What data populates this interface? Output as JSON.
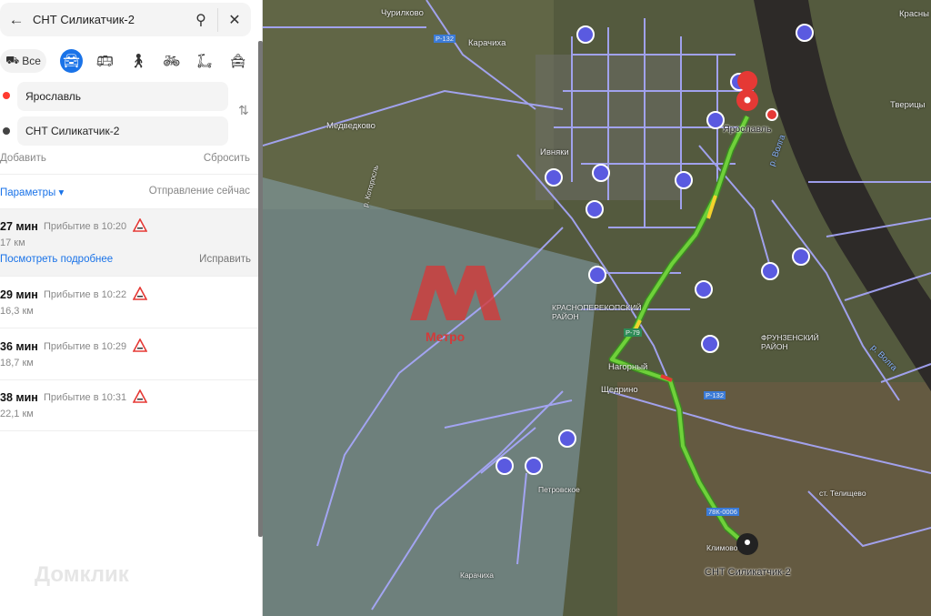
{
  "search": {
    "query": "СНТ Силикатчик-2"
  },
  "modes": {
    "all_label": "Все",
    "items": [
      "car",
      "bus",
      "walk",
      "bike",
      "scooter",
      "taxi"
    ]
  },
  "points": {
    "from": "Ярославль",
    "to": "СНТ Силикатчик-2"
  },
  "actions": {
    "add": "Добавить",
    "reset": "Сбросить",
    "params": "Параметры ▾",
    "departure": "Отправление сейчас",
    "details": "Посмотреть подробнее",
    "fix": "Исправить"
  },
  "routes": [
    {
      "time": "27 мин",
      "arrival": "Прибытие в 10:20",
      "distance": "17 км"
    },
    {
      "time": "29 мин",
      "arrival": "Прибытие в 10:22",
      "distance": "16,3 км"
    },
    {
      "time": "36 мин",
      "arrival": "Прибытие в 10:29",
      "distance": "18,7 км"
    },
    {
      "time": "38 мин",
      "arrival": "Прибытие в 10:31",
      "distance": "22,1 км"
    }
  ],
  "map": {
    "labels": {
      "churilkovo": "Чурилково",
      "karachikha1": "Карачиха",
      "medvedkovo": "Медведково",
      "yaroslavl": "Ярославль",
      "krasnoperekopsky": "КРАСНОПЕРЕКОПСКИЙ РАЙОН",
      "frunzensky": "ФРУНЗЕНСКИЙ РАЙОН",
      "nagorny": "Нагорный",
      "shchedrino": "Щедрино",
      "petrovskoe": "Петровское",
      "karachikha2": "Карачиха",
      "klimovo": "Климово",
      "telishchevo": "ст. Телищево",
      "volga1": "р. Волга",
      "volga2": "р. Волга",
      "kotorosl": "р. Которосль",
      "tveritsy": "Тверицы",
      "ivnyaki": "Ивняки",
      "krasny": "Красны"
    },
    "roads": {
      "r1": "Р-132",
      "r2": "Р-132",
      "r3": "78К-0006",
      "r4": "Р-79"
    },
    "destination": "СНТ Силикатчик-2",
    "watermarks": {
      "metro": "Метро",
      "domclick": "Домклик"
    },
    "colors": {
      "route_green": "#6fd13a",
      "route_yellow": "#f4d22c",
      "route_red": "#e53935",
      "roads": "#a9a9ff",
      "start": "#ff3b30"
    }
  }
}
